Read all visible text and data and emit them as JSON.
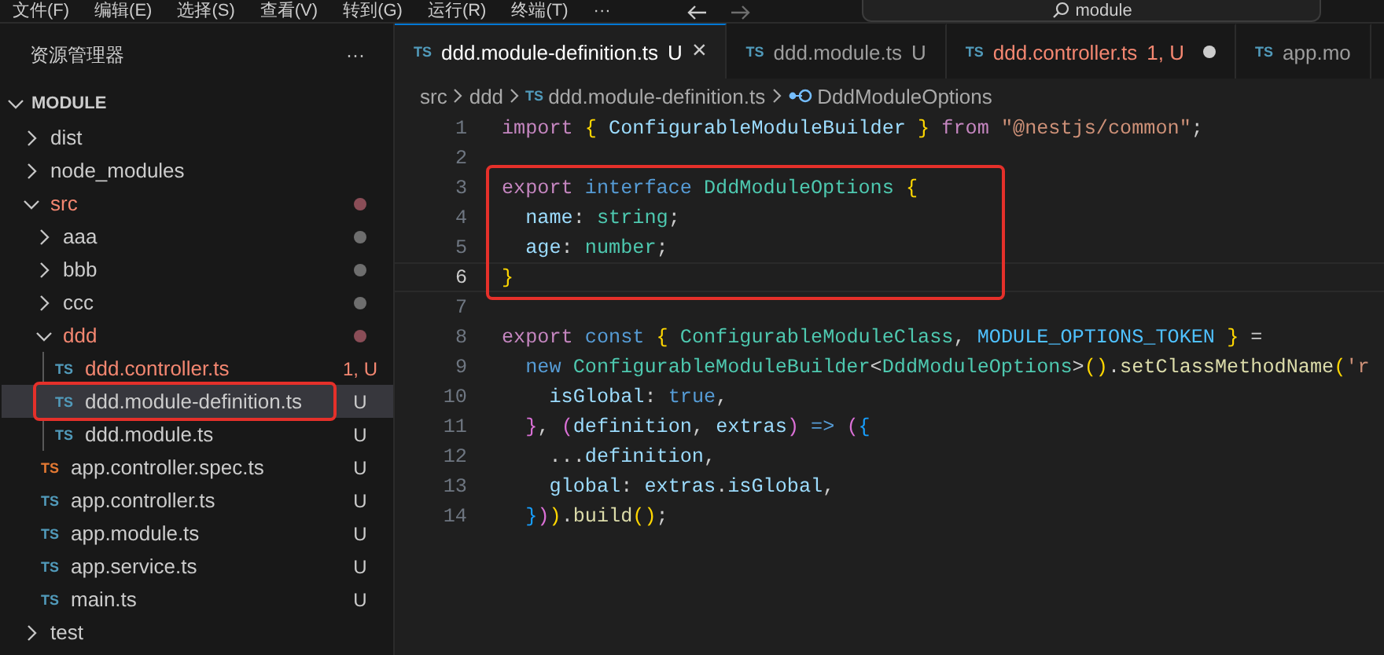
{
  "menu_bar": {
    "items": [
      "文件(F)",
      "编辑(E)",
      "选择(S)",
      "查看(V)",
      "转到(G)",
      "运行(R)",
      "终端(T)",
      "···"
    ],
    "search": {
      "value": "module"
    }
  },
  "sidebar": {
    "title": "资源管理器",
    "more": "···",
    "section": {
      "title": "MODULE",
      "expanded": true
    },
    "tree": [
      {
        "name": "dist",
        "kind": "folder",
        "expanded": false
      },
      {
        "name": "node_modules",
        "kind": "folder",
        "expanded": false
      },
      {
        "name": "src",
        "kind": "folder",
        "expanded": true,
        "error": true,
        "color": "#8a4d57",
        "children": [
          {
            "name": "aaa",
            "kind": "folder",
            "expanded": false,
            "color": "#6e6e6e"
          },
          {
            "name": "bbb",
            "kind": "folder",
            "expanded": false,
            "color": "#6e6e6e"
          },
          {
            "name": "ccc",
            "kind": "folder",
            "expanded": false,
            "color": "#6e6e6e"
          },
          {
            "name": "ddd",
            "kind": "folder",
            "expanded": true,
            "error": true,
            "color": "#8a4d57",
            "children": [
              {
                "name": "ddd.controller.ts",
                "kind": "file",
                "icon": "TS",
                "error": true,
                "badge": "1, U",
                "selected": false,
                "annotated": false
              },
              {
                "name": "ddd.module-definition.ts",
                "kind": "file",
                "icon": "TS",
                "badge": "U",
                "selected": true,
                "annotated": true
              },
              {
                "name": "ddd.module.ts",
                "kind": "file",
                "icon": "TS",
                "badge": "U",
                "selected": false,
                "annotated": false
              }
            ]
          },
          {
            "name": "app.controller.spec.ts",
            "kind": "file",
            "icon": "TS",
            "test": true,
            "badge": "U",
            "selected": false,
            "annotated": false
          },
          {
            "name": "app.controller.ts",
            "kind": "file",
            "icon": "TS",
            "badge": "U",
            "selected": false,
            "annotated": false
          },
          {
            "name": "app.module.ts",
            "kind": "file",
            "icon": "TS",
            "badge": "U",
            "selected": false,
            "annotated": false
          },
          {
            "name": "app.service.ts",
            "kind": "file",
            "icon": "TS",
            "badge": "U",
            "selected": false,
            "annotated": false
          },
          {
            "name": "main.ts",
            "kind": "file",
            "icon": "TS",
            "badge": "U",
            "selected": false,
            "annotated": false
          }
        ]
      },
      {
        "name": "test",
        "kind": "folder",
        "expanded": false
      }
    ]
  },
  "tabs": [
    {
      "icon": "TS",
      "label": "ddd.module-definition.ts",
      "status": "U",
      "selected": true,
      "error": false,
      "close": "×"
    },
    {
      "icon": "TS",
      "label": "ddd.module.ts",
      "status": "U",
      "selected": false,
      "error": false
    },
    {
      "icon": "TS",
      "label": "ddd.controller.ts",
      "status": "1, U",
      "selected": false,
      "error": true,
      "modified": true
    },
    {
      "icon": "TS",
      "label": "app.mo",
      "selected": false,
      "error": false
    }
  ],
  "breadcrumbs": [
    {
      "label": "src",
      "kind": "folder"
    },
    {
      "label": "ddd",
      "kind": "folder"
    },
    {
      "label": "ddd.module-definition.ts",
      "kind": "file",
      "icon": "TS"
    },
    {
      "label": "DddModuleOptions",
      "kind": "symbol"
    }
  ],
  "code": [
    {
      "number": "1",
      "tokens": [
        {
          "t": "import ",
          "kind": "kw"
        },
        {
          "t": "{",
          "kind": "b1"
        },
        {
          "t": " ConfigurableModuleBuilder ",
          "kind": "var"
        },
        {
          "t": "}",
          "kind": "b1"
        },
        {
          "t": " from ",
          "kind": "kw"
        },
        {
          "t": "\"@nestjs/common\"",
          "kind": "str"
        },
        {
          "t": ";",
          "kind": "plain"
        }
      ]
    },
    {
      "number": "2"
    },
    {
      "number": "3",
      "annotated": true,
      "tokens": [
        {
          "t": "export ",
          "kind": "kw"
        },
        {
          "t": "interface ",
          "kind": "storage"
        },
        {
          "t": "DddModuleOptions ",
          "kind": "type"
        },
        {
          "t": "{",
          "kind": "b1"
        }
      ]
    },
    {
      "number": "4",
      "annotated": true,
      "tokens": [
        {
          "t": "  name",
          "kind": "var"
        },
        {
          "t": ": ",
          "kind": "plain"
        },
        {
          "t": "string",
          "kind": "type"
        },
        {
          "t": ";",
          "kind": "plain"
        }
      ]
    },
    {
      "number": "5",
      "annotated": true,
      "tokens": [
        {
          "t": "  age",
          "kind": "var"
        },
        {
          "t": ": ",
          "kind": "plain"
        },
        {
          "t": "number",
          "kind": "type"
        },
        {
          "t": ";",
          "kind": "plain"
        }
      ]
    },
    {
      "number": "6",
      "annotated": true,
      "current": true,
      "tokens": [
        {
          "t": "}",
          "kind": "b1"
        }
      ]
    },
    {
      "number": "7"
    },
    {
      "number": "8",
      "tokens": [
        {
          "t": "export ",
          "kind": "kw"
        },
        {
          "t": "const ",
          "kind": "storage"
        },
        {
          "t": "{",
          "kind": "b1"
        },
        {
          "t": " ConfigurableModuleClass",
          "kind": "type"
        },
        {
          "t": ", ",
          "kind": "plain"
        },
        {
          "t": "MODULE_OPTIONS_TOKEN ",
          "kind": "const"
        },
        {
          "t": "}",
          "kind": "b1"
        },
        {
          "t": " =",
          "kind": "plain"
        }
      ]
    },
    {
      "number": "9",
      "tokens": [
        {
          "t": "  new ",
          "kind": "storage"
        },
        {
          "t": "ConfigurableModuleBuilder",
          "kind": "type"
        },
        {
          "t": "<",
          "kind": "plain"
        },
        {
          "t": "DddModuleOptions",
          "kind": "type"
        },
        {
          "t": ">",
          "kind": "plain"
        },
        {
          "t": "()",
          "kind": "b1"
        },
        {
          "t": ".",
          "kind": "plain"
        },
        {
          "t": "setClassMethodName",
          "kind": "fn"
        },
        {
          "t": "(",
          "kind": "b1"
        },
        {
          "t": "'r",
          "kind": "str"
        }
      ]
    },
    {
      "number": "10",
      "tokens": [
        {
          "t": "    isGlobal",
          "kind": "var"
        },
        {
          "t": ": ",
          "kind": "plain"
        },
        {
          "t": "true",
          "kind": "storage"
        },
        {
          "t": ",",
          "kind": "plain"
        }
      ]
    },
    {
      "number": "11",
      "tokens": [
        {
          "t": "  }",
          "kind": "b2"
        },
        {
          "t": ", ",
          "kind": "plain"
        },
        {
          "t": "(",
          "kind": "b2"
        },
        {
          "t": "definition",
          "kind": "var"
        },
        {
          "t": ", ",
          "kind": "plain"
        },
        {
          "t": "extras",
          "kind": "var"
        },
        {
          "t": ")",
          "kind": "b2"
        },
        {
          "t": " => ",
          "kind": "storage"
        },
        {
          "t": "(",
          "kind": "b2"
        },
        {
          "t": "{",
          "kind": "b3"
        }
      ]
    },
    {
      "number": "12",
      "tokens": [
        {
          "t": "    ...",
          "kind": "plain"
        },
        {
          "t": "definition",
          "kind": "var"
        },
        {
          "t": ",",
          "kind": "plain"
        }
      ]
    },
    {
      "number": "13",
      "tokens": [
        {
          "t": "    global",
          "kind": "var"
        },
        {
          "t": ": ",
          "kind": "plain"
        },
        {
          "t": "extras",
          "kind": "var"
        },
        {
          "t": ".",
          "kind": "plain"
        },
        {
          "t": "isGlobal",
          "kind": "var"
        },
        {
          "t": ",",
          "kind": "plain"
        }
      ]
    },
    {
      "number": "14",
      "tokens": [
        {
          "t": "  }",
          "kind": "b3"
        },
        {
          "t": ")",
          "kind": "b2"
        },
        {
          "t": ")",
          "kind": "b1"
        },
        {
          "t": ".",
          "kind": "plain"
        },
        {
          "t": "build",
          "kind": "fn"
        },
        {
          "t": "()",
          "kind": "b1"
        },
        {
          "t": ";",
          "kind": "plain"
        }
      ]
    }
  ]
}
